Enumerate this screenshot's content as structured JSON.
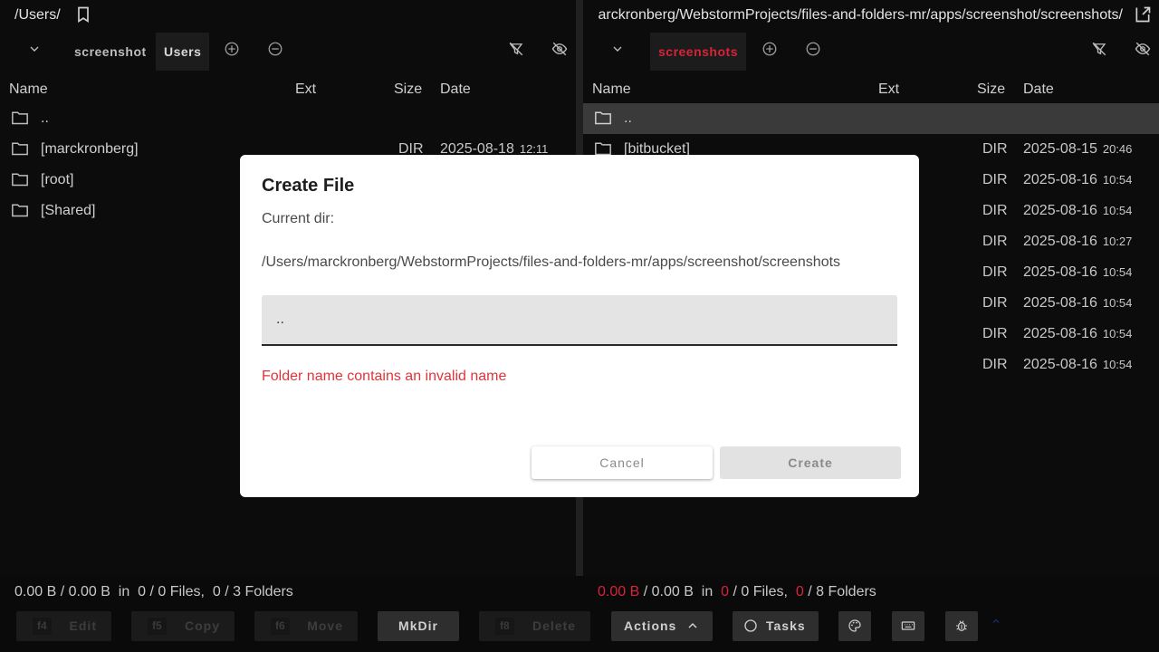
{
  "colors": {
    "accent": "#d8233a",
    "error": "#e0343a",
    "selected_row": "#3a3a3a"
  },
  "left": {
    "path": "/Users/",
    "path_icon": "bookmark-icon",
    "tabs": [
      {
        "label": "screenshot"
      },
      {
        "label": "Users",
        "active": true
      }
    ],
    "columns": {
      "name": "Name",
      "ext": "Ext",
      "size": "Size",
      "date": "Date"
    },
    "rows": [
      {
        "name": "..",
        "size": "",
        "date": "",
        "time": ""
      },
      {
        "name": "[marckronberg]",
        "size": "DIR",
        "date": "2025-08-18",
        "time": "12:11"
      },
      {
        "name": "[root]",
        "size": "",
        "date": "",
        "time": ""
      },
      {
        "name": "[Shared]",
        "size": "",
        "date": "",
        "time": ""
      }
    ],
    "status": {
      "sel": "0.00 B",
      "total": "0.00 B",
      "in": "in",
      "files_sel": "0",
      "files_total": "0",
      "files_label": "Files,",
      "folders_sel": "0",
      "folders_total": "3",
      "folders_label": "Folders"
    }
  },
  "right": {
    "path": "arckronberg/WebstormProjects/files-and-folders-mr/apps/screenshot/screenshots/",
    "path_icon": "open-in-new-icon",
    "tabs": [
      {
        "label": "screenshots",
        "active": true
      }
    ],
    "columns": {
      "name": "Name",
      "ext": "Ext",
      "size": "Size",
      "date": "Date"
    },
    "rows": [
      {
        "name": "..",
        "size": "",
        "date": "",
        "time": "",
        "selected": true
      },
      {
        "name": "[bitbucket]",
        "size": "DIR",
        "date": "2025-08-15",
        "time": "20:46"
      },
      {
        "name": "",
        "size": "DIR",
        "date": "2025-08-16",
        "time": "10:54"
      },
      {
        "name": "",
        "size": "DIR",
        "date": "2025-08-16",
        "time": "10:54"
      },
      {
        "name": "",
        "size": "DIR",
        "date": "2025-08-16",
        "time": "10:27"
      },
      {
        "name": "",
        "size": "DIR",
        "date": "2025-08-16",
        "time": "10:54"
      },
      {
        "name": "",
        "size": "DIR",
        "date": "2025-08-16",
        "time": "10:54"
      },
      {
        "name": "",
        "size": "DIR",
        "date": "2025-08-16",
        "time": "10:54"
      },
      {
        "name": "",
        "size": "DIR",
        "date": "2025-08-16",
        "time": "10:54"
      }
    ],
    "status": {
      "sel": "0.00 B",
      "total": "0.00 B",
      "in": "in",
      "files_sel": "0",
      "files_total": "0",
      "files_label": "Files,",
      "folders_sel": "0",
      "folders_total": "8",
      "folders_label": "Folders"
    }
  },
  "footer": {
    "edit": {
      "key": "f4",
      "label": "Edit"
    },
    "copy": {
      "key": "f5",
      "label": "Copy"
    },
    "move": {
      "key": "f6",
      "label": "Move"
    },
    "mkdir": {
      "label": "MkDir"
    },
    "delete": {
      "key": "f8",
      "label": "Delete"
    },
    "actions": {
      "label": "Actions"
    },
    "tasks": {
      "label": "Tasks"
    }
  },
  "dialog": {
    "title": "Create File",
    "current_dir_label": "Current dir:",
    "current_dir": "/Users/marckronberg/WebstormProjects/files-and-folders-mr/apps/screenshot/screenshots",
    "input_value": "..",
    "error": "Folder name contains an invalid name",
    "cancel": "Cancel",
    "create": "Create"
  }
}
